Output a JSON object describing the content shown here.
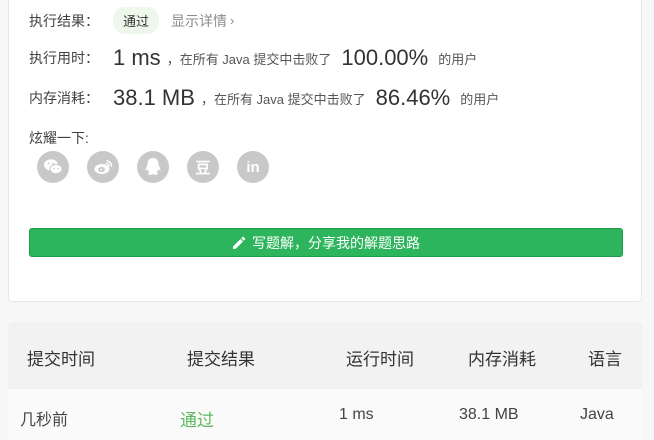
{
  "result": {
    "label": "执行结果：",
    "status": "通过",
    "details_link": "显示详情",
    "details_chevron": "›"
  },
  "runtime": {
    "label": "执行用时：",
    "value": "1 ms",
    "mid_text": "，在所有 Java 提交中击败了",
    "percent": "100.00%",
    "suffix": "的用户"
  },
  "memory": {
    "label": "内存消耗：",
    "value": "38.1 MB",
    "mid_text": "，在所有 Java 提交中击败了",
    "percent": "86.46%",
    "suffix": "的用户"
  },
  "share": {
    "label": "炫耀一下:",
    "icons": [
      "wechat-icon",
      "weibo-icon",
      "qq-icon",
      "douban-icon",
      "linkedin-icon"
    ],
    "douban_glyph": "豆",
    "linkedin_glyph": "in"
  },
  "write_button": {
    "label": "写题解，分享我的解题思路"
  },
  "submissions": {
    "headers": [
      "提交时间",
      "提交结果",
      "运行时间",
      "内存消耗",
      "语言"
    ],
    "rows": [
      [
        "几秒前",
        "通过",
        "1 ms",
        "38.1 MB",
        "Java"
      ]
    ]
  },
  "colors": {
    "accent_green": "#2db55d",
    "pass_text": "#5cb85c",
    "icon_gray": "#c8c8c8"
  }
}
